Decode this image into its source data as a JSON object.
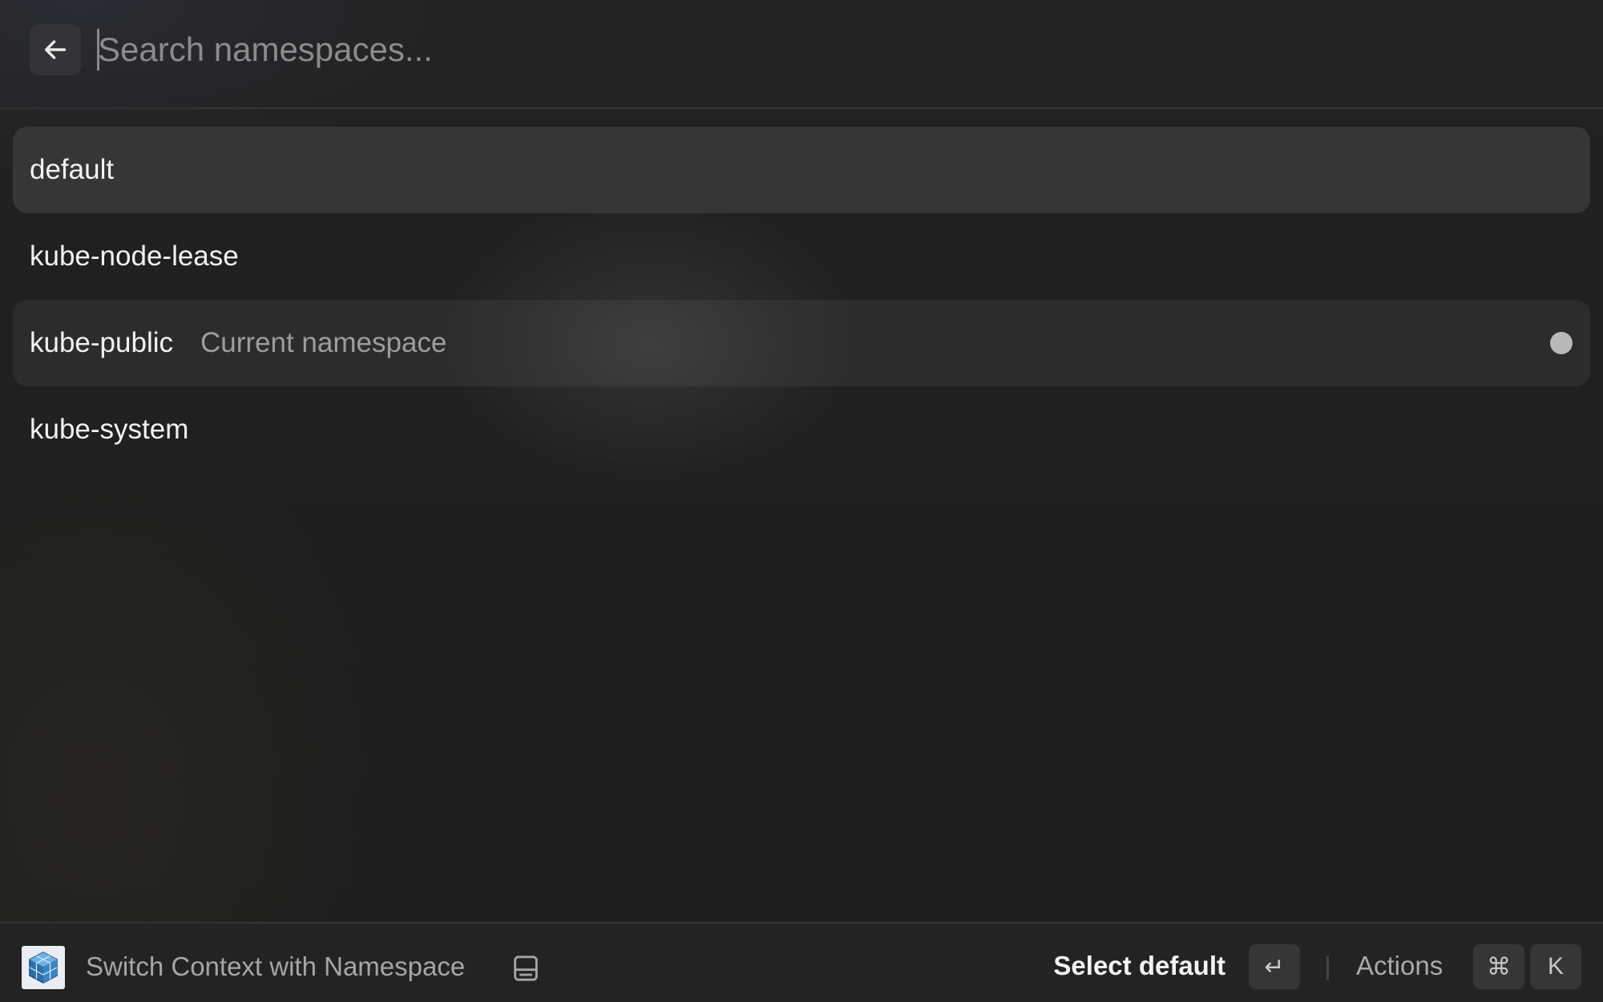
{
  "search": {
    "placeholder": "Search namespaces...",
    "value": ""
  },
  "namespaces": [
    {
      "name": "default",
      "subtitle": "",
      "selected": true,
      "current": false
    },
    {
      "name": "kube-node-lease",
      "subtitle": "",
      "selected": false,
      "current": false
    },
    {
      "name": "kube-public",
      "subtitle": "Current namespace",
      "selected": false,
      "current": true
    },
    {
      "name": "kube-system",
      "subtitle": "",
      "selected": false,
      "current": false
    }
  ],
  "footer": {
    "extension_icon": "kubernetes-cube-icon",
    "extension_title": "Switch Context with Namespace",
    "drive_icon": "hard-drive-icon",
    "primary_action": "Select default",
    "enter_key": "↵",
    "actions_label": "Actions",
    "cmd_key": "⌘",
    "k_key": "K"
  },
  "colors": {
    "background": "#1d1d1d",
    "selected_row": "#363636",
    "text_primary": "#f2f2f2",
    "text_secondary": "#9d9d9d",
    "accessory_dot": "#b8b8b8"
  }
}
